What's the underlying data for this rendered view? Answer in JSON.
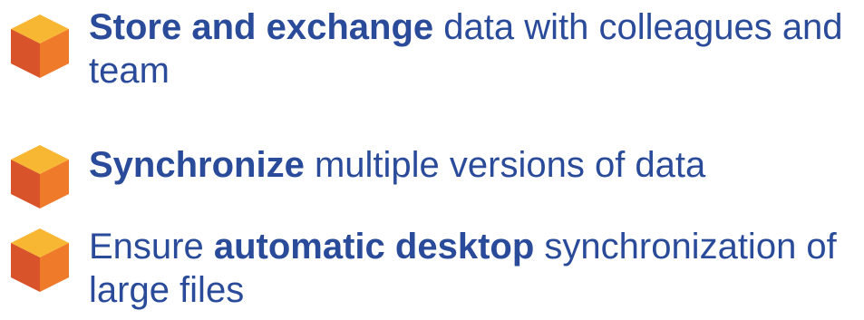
{
  "colors": {
    "text": "#2a4b9a",
    "cube_top": "#f7b733",
    "cube_left": "#d9532a",
    "cube_right": "#ef7a2a"
  },
  "bullets": [
    {
      "icon": "cube-icon",
      "bold": "Store and exchange",
      "rest": " data with colleagues and team"
    },
    {
      "icon": "cube-icon",
      "bold": "Synchronize",
      "rest": " multiple versions of data"
    },
    {
      "icon": "cube-icon",
      "prefix": "Ensure ",
      "bold": "automatic desktop",
      "rest": " synchronization of large files"
    }
  ]
}
